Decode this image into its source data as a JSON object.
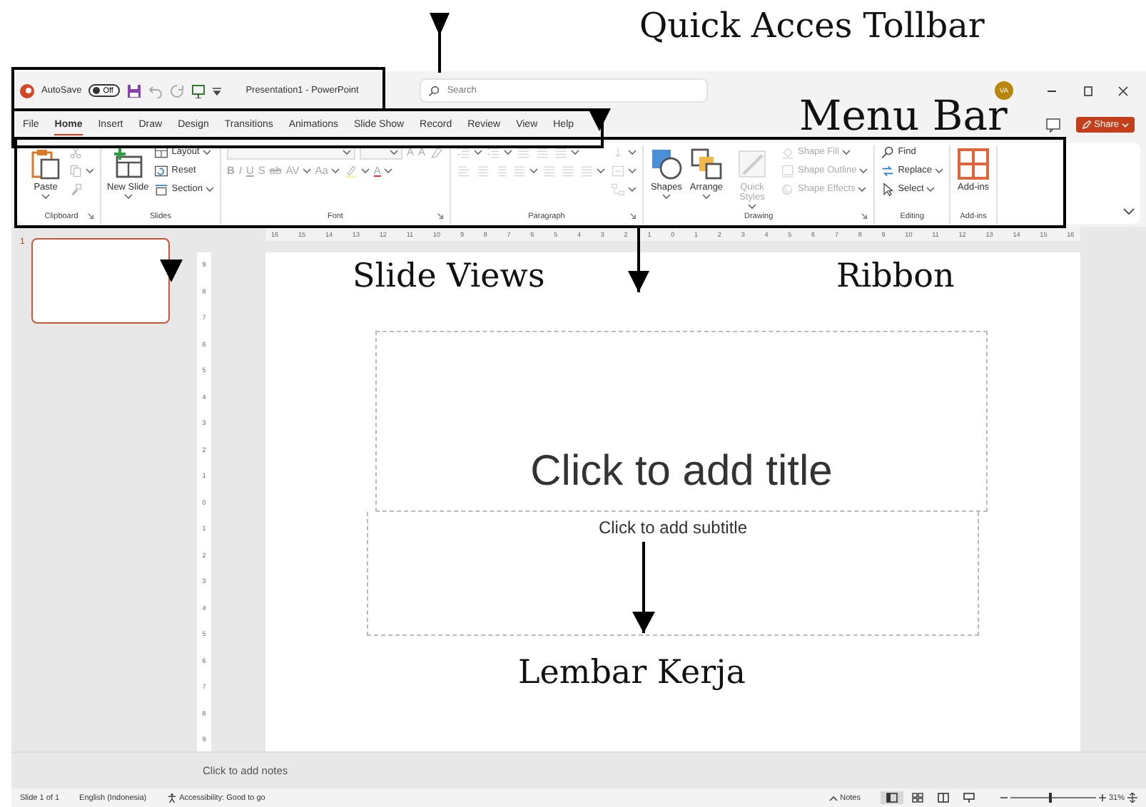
{
  "annotations": [
    {
      "kind": "qat",
      "text": "Quick Acces Tollbar"
    },
    {
      "kind": "menu",
      "text": "Menu Bar"
    },
    {
      "kind": "slides",
      "text": "Slide Views"
    },
    {
      "kind": "ribbon",
      "text": "Ribbon"
    },
    {
      "kind": "workspace",
      "text": "Lembar Kerja"
    }
  ],
  "title_bar": {
    "autosave": {
      "label": "AutoSave",
      "toggle": "Off",
      "on": false
    },
    "title": "Presentation1 - PowerPoint",
    "search": {
      "placeholder": "Search"
    },
    "avatar": "VA"
  },
  "tabs": [
    {
      "label": "File",
      "selected": false
    },
    {
      "label": "Home",
      "selected": true
    },
    {
      "label": "Insert",
      "selected": false
    },
    {
      "label": "Draw",
      "selected": false
    },
    {
      "label": "Design",
      "selected": false
    },
    {
      "label": "Transitions",
      "selected": false
    },
    {
      "label": "Animations",
      "selected": false
    },
    {
      "label": "Slide Show",
      "selected": false
    },
    {
      "label": "Record",
      "selected": false
    },
    {
      "label": "Review",
      "selected": false
    },
    {
      "label": "View",
      "selected": false
    },
    {
      "label": "Help",
      "selected": false
    }
  ],
  "share_button": "Share",
  "ribbon": [
    {
      "label": "Clipboard",
      "launcher": true,
      "columns": [
        [
          [
            {
              "kind": "paste",
              "label": "Paste",
              "large": true,
              "menu": true,
              "disabled": false
            }
          ]
        ],
        [
          [
            {
              "kind": "cut",
              "large": false,
              "menu": false,
              "disabled": true
            }
          ],
          [
            {
              "kind": "copy",
              "large": false,
              "menu": true,
              "disabled": true
            }
          ],
          [
            {
              "kind": "format-painter",
              "large": false,
              "menu": false,
              "disabled": true
            }
          ]
        ]
      ]
    },
    {
      "label": "Slides",
      "launcher": false,
      "columns": [
        [
          [
            {
              "kind": "new-slide",
              "label": "New Slide",
              "large": true,
              "menu": true,
              "disabled": false
            }
          ]
        ],
        [
          [
            {
              "kind": "layout",
              "label": "Layout",
              "large": false,
              "menu": true,
              "disabled": false
            }
          ],
          [
            {
              "kind": "reset",
              "label": "Reset",
              "large": false,
              "menu": false,
              "disabled": false
            }
          ],
          [
            {
              "kind": "section",
              "label": "Section",
              "large": false,
              "menu": true,
              "disabled": false
            }
          ]
        ]
      ]
    },
    {
      "label": "Font",
      "launcher": true,
      "columns": [
        [
          [
            {
              "kind": "font-name-field",
              "menu": true,
              "disabled": true
            },
            {
              "kind": "font-size-field",
              "menu": true,
              "disabled": true
            },
            {
              "kind": "grow",
              "label": "A",
              "large": false,
              "menu": false,
              "disabled": true
            },
            {
              "kind": "shrink",
              "label": "A",
              "large": false,
              "menu": false,
              "disabled": true
            },
            {
              "kind": "clear",
              "large": false,
              "menu": false,
              "disabled": true
            }
          ],
          [
            {
              "kind": "bold",
              "label": "B",
              "large": false,
              "menu": false,
              "disabled": true
            },
            {
              "kind": "italic",
              "label": "I",
              "large": false,
              "menu": false,
              "disabled": true
            },
            {
              "kind": "underline",
              "label": "U",
              "large": false,
              "menu": false,
              "disabled": true
            },
            {
              "kind": "shadow",
              "label": "S",
              "large": false,
              "menu": false,
              "disabled": true
            },
            {
              "kind": "strike",
              "label": "ab",
              "large": false,
              "menu": false,
              "disabled": true
            },
            {
              "kind": "spacing",
              "label": "AV",
              "large": false,
              "menu": true,
              "disabled": true
            },
            {
              "kind": "case",
              "label": "Aa",
              "large": false,
              "menu": true,
              "disabled": true
            },
            {
              "kind": "highlight",
              "large": false,
              "menu": true,
              "disabled": true
            },
            {
              "kind": "font-color",
              "label": "A",
              "large": false,
              "menu": true,
              "disabled": true
            }
          ]
        ]
      ]
    },
    {
      "label": "Paragraph",
      "launcher": true,
      "columns": [
        [
          [
            {
              "kind": "bullets",
              "large": false,
              "menu": true,
              "disabled": true
            },
            {
              "kind": "numbering",
              "large": false,
              "menu": true,
              "disabled": true
            },
            {
              "kind": "indent-less",
              "large": false,
              "menu": false,
              "disabled": true
            },
            {
              "kind": "indent-more",
              "large": false,
              "menu": false,
              "disabled": true
            },
            {
              "kind": "line-spacing",
              "large": false,
              "menu": true,
              "disabled": true
            }
          ],
          [
            {
              "kind": "align-left",
              "large": false,
              "menu": false,
              "disabled": true
            },
            {
              "kind": "align-center",
              "large": false,
              "menu": false,
              "disabled": true
            },
            {
              "kind": "align-right",
              "large": false,
              "menu": false,
              "disabled": true
            },
            {
              "kind": "justify",
              "large": false,
              "menu": true,
              "disabled": true
            },
            {
              "kind": "rtl",
              "large": false,
              "menu": false,
              "disabled": true
            },
            {
              "kind": "ltr",
              "large": false,
              "menu": false,
              "disabled": true
            },
            {
              "kind": "columns",
              "large": false,
              "menu": true,
              "disabled": true
            }
          ]
        ],
        [
          [
            {
              "kind": "text-direction",
              "large": false,
              "menu": true,
              "disabled": true
            }
          ],
          [
            {
              "kind": "align-text",
              "large": false,
              "menu": true,
              "disabled": true
            }
          ],
          [
            {
              "kind": "smartart",
              "large": false,
              "menu": true,
              "disabled": true
            }
          ]
        ]
      ]
    },
    {
      "label": "Drawing",
      "launcher": true,
      "columns": [
        [
          [
            {
              "kind": "shapes",
              "label": "Shapes",
              "large": true,
              "menu": true,
              "disabled": false
            }
          ]
        ],
        [
          [
            {
              "kind": "arrange",
              "label": "Arrange",
              "large": true,
              "menu": true,
              "disabled": false
            }
          ]
        ],
        [
          [
            {
              "kind": "quick-styles",
              "label": "Quick Styles",
              "large": true,
              "menu": true,
              "disabled": true
            }
          ]
        ],
        [
          [
            {
              "kind": "shape-fill",
              "label": "Shape Fill",
              "large": false,
              "menu": true,
              "disabled": true
            }
          ],
          [
            {
              "kind": "shape-outline",
              "label": "Shape Outline",
              "large": false,
              "menu": true,
              "disabled": true
            }
          ],
          [
            {
              "kind": "shape-effects",
              "label": "Shape Effects",
              "large": false,
              "menu": true,
              "disabled": true
            }
          ]
        ]
      ]
    },
    {
      "label": "Editing",
      "launcher": false,
      "columns": [
        [
          [
            {
              "kind": "find",
              "label": "Find",
              "large": false,
              "menu": false,
              "disabled": false
            }
          ],
          [
            {
              "kind": "replace",
              "label": "Replace",
              "large": false,
              "menu": true,
              "disabled": false
            }
          ],
          [
            {
              "kind": "select",
              "label": "Select",
              "large": false,
              "menu": true,
              "disabled": false
            }
          ]
        ]
      ]
    },
    {
      "label": "Add-ins",
      "launcher": false,
      "columns": [
        [
          [
            {
              "kind": "add-ins",
              "label": "Add-ins",
              "large": true,
              "menu": false,
              "disabled": false
            }
          ]
        ]
      ]
    }
  ],
  "slides": [
    {
      "number": "1",
      "selected": true
    }
  ],
  "horizontal_ruler": [
    "16",
    "15",
    "14",
    "13",
    "12",
    "11",
    "10",
    "9",
    "8",
    "7",
    "6",
    "5",
    "4",
    "3",
    "2",
    "1",
    "0",
    "1",
    "2",
    "3",
    "4",
    "5",
    "6",
    "7",
    "8",
    "9",
    "10",
    "11",
    "12",
    "13",
    "14",
    "15",
    "16"
  ],
  "vertical_ruler": [
    "9",
    "8",
    "7",
    "6",
    "5",
    "4",
    "3",
    "2",
    "1",
    "0",
    "1",
    "2",
    "3",
    "4",
    "5",
    "6",
    "7",
    "8",
    "9"
  ],
  "slide": {
    "title_placeholder": "Click to add title",
    "subtitle_placeholder": "Click to add subtitle"
  },
  "notes_placeholder": "Click to add notes",
  "status_bar": {
    "slide_count": "Slide 1 of 1",
    "language": "English (Indonesia)",
    "accessibility": "Accessibility: Good to go",
    "notes": "Notes",
    "views": [
      {
        "kind": "normal",
        "selected": true
      },
      {
        "kind": "sorter",
        "selected": false
      },
      {
        "kind": "reading",
        "selected": false
      },
      {
        "kind": "slideshow",
        "selected": false
      }
    ],
    "zoom_slider": {
      "level": 0.45
    },
    "zoom": "31%"
  }
}
